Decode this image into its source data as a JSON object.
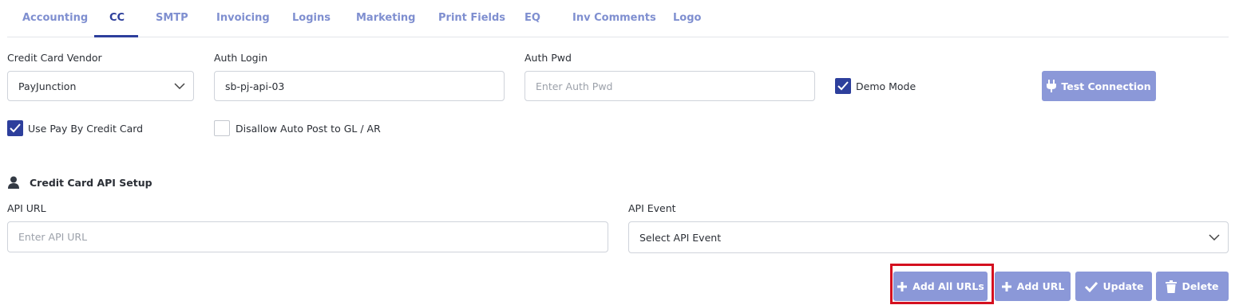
{
  "tabs": [
    {
      "label": "Accounting"
    },
    {
      "label": "CC",
      "active": true
    },
    {
      "label": "SMTP"
    },
    {
      "label": "Invoicing"
    },
    {
      "label": "Logins"
    },
    {
      "label": "Marketing"
    },
    {
      "label": "Print Fields"
    },
    {
      "label": "EQ"
    },
    {
      "label": "Inv Comments"
    },
    {
      "label": "Logo"
    }
  ],
  "form": {
    "vendor_label": "Credit Card Vendor",
    "vendor_value": "PayJunction",
    "auth_login_label": "Auth Login",
    "auth_login_value": "sb-pj-api-03",
    "auth_pwd_label": "Auth Pwd",
    "auth_pwd_placeholder": "Enter Auth Pwd",
    "demo_mode_label": "Demo Mode",
    "demo_mode_checked": true,
    "test_connection_label": "Test Connection",
    "use_pay_by_cc_label": "Use Pay By Credit Card",
    "use_pay_by_cc_checked": true,
    "disallow_auto_post_label": "Disallow Auto Post to GL / AR",
    "disallow_auto_post_checked": false
  },
  "api_setup": {
    "section_title": "Credit Card API Setup",
    "api_url_label": "API URL",
    "api_url_placeholder": "Enter API URL",
    "api_event_label": "API Event",
    "api_event_placeholder": "Select API Event"
  },
  "actions": {
    "add_all_urls": "Add All URLs",
    "add_url": "Add URL",
    "update": "Update",
    "delete": "Delete"
  },
  "colors": {
    "accent": "#2d3f9c",
    "tab_inactive": "#7f8fd0",
    "button_bg": "#8b98d8",
    "highlight_box": "#d4101f"
  }
}
